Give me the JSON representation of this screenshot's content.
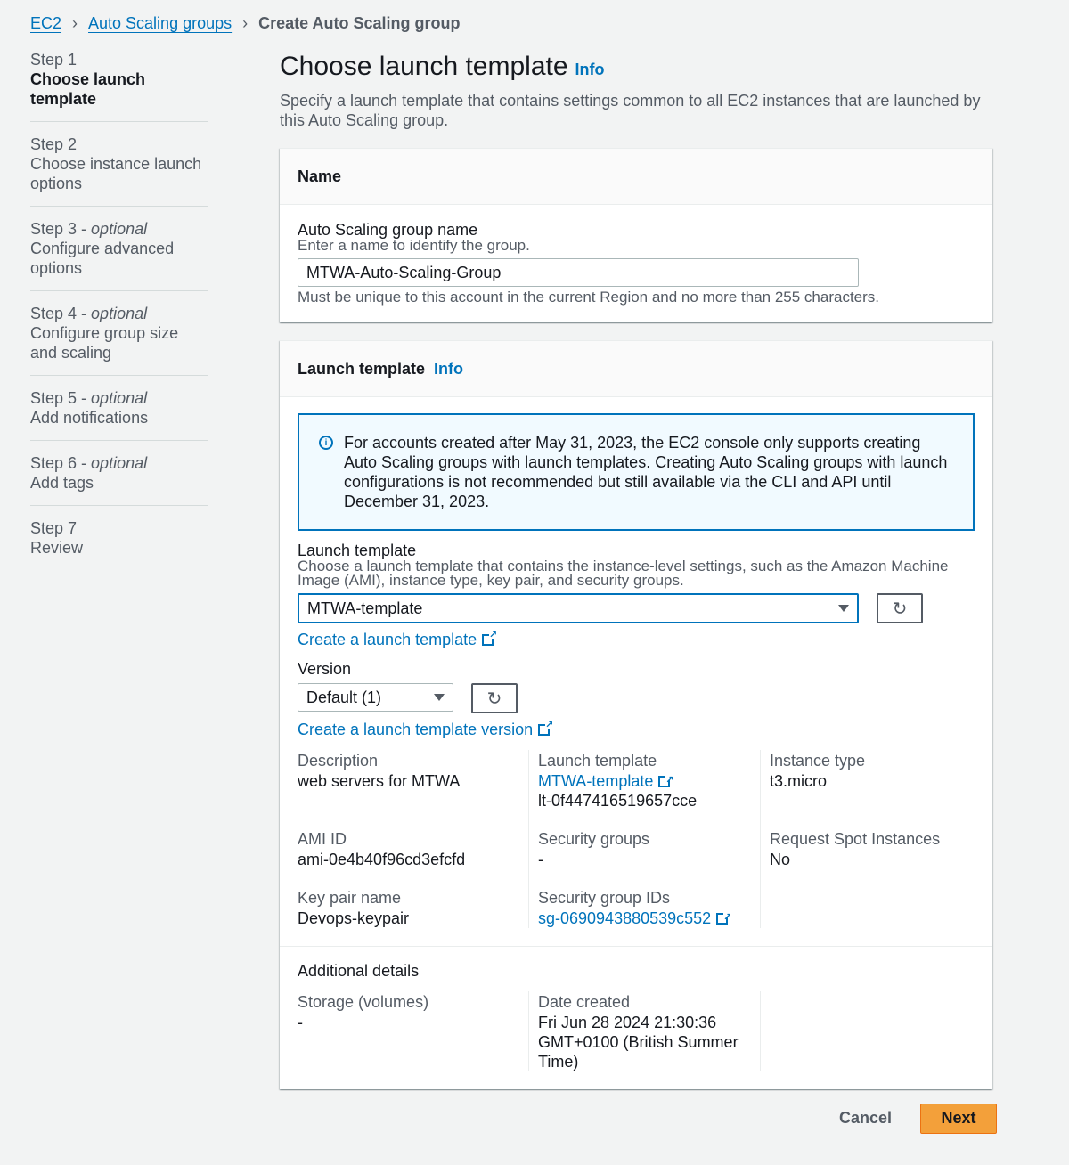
{
  "breadcrumb": {
    "items": [
      "EC2",
      "Auto Scaling groups"
    ],
    "current": "Create Auto Scaling group"
  },
  "steps": [
    {
      "num": "Step 1",
      "optional": "",
      "title": "Choose launch template"
    },
    {
      "num": "Step 2",
      "optional": "",
      "title": "Choose instance launch options"
    },
    {
      "num": "Step 3",
      "optional": "optional",
      "title": "Configure advanced options"
    },
    {
      "num": "Step 4",
      "optional": "optional",
      "title": "Configure group size and scaling"
    },
    {
      "num": "Step 5",
      "optional": "optional",
      "title": "Add notifications"
    },
    {
      "num": "Step 6",
      "optional": "optional",
      "title": "Add tags"
    },
    {
      "num": "Step 7",
      "optional": "",
      "title": "Review"
    }
  ],
  "page": {
    "title": "Choose launch template",
    "info": "Info",
    "description": "Specify a launch template that contains settings common to all EC2 instances that are launched by this Auto Scaling group."
  },
  "name_panel": {
    "header": "Name",
    "label": "Auto Scaling group name",
    "desc": "Enter a name to identify the group.",
    "value": "MTWA-Auto-Scaling-Group",
    "hint": "Must be unique to this account in the current Region and no more than 255 characters."
  },
  "launch_panel": {
    "header": "Launch template",
    "info": "Info",
    "alert": "For accounts created after May 31, 2023, the EC2 console only supports creating Auto Scaling groups with launch templates. Creating Auto Scaling groups with launch configurations is not recommended but still available via the CLI and API until December 31, 2023.",
    "lt_label": "Launch template",
    "lt_desc": "Choose a launch template that contains the instance-level settings, such as the Amazon Machine Image (AMI), instance type, key pair, and security groups.",
    "lt_value": "MTWA-template",
    "create_lt": "Create a launch template",
    "version_label": "Version",
    "version_value": "Default (1)",
    "create_version": "Create a launch template version",
    "details": {
      "description_key": "Description",
      "description_val": "web servers for MTWA",
      "lt_key": "Launch template",
      "lt_link": "MTWA-template",
      "lt_id": "lt-0f447416519657cce",
      "instance_type_key": "Instance type",
      "instance_type_val": "t3.micro",
      "ami_key": "AMI ID",
      "ami_val": "ami-0e4b40f96cd3efcfd",
      "sg_key": "Security groups",
      "sg_val": "-",
      "spot_key": "Request Spot Instances",
      "spot_val": "No",
      "keypair_key": "Key pair name",
      "keypair_val": "Devops-keypair",
      "sgid_key": "Security group IDs",
      "sgid_val": "sg-0690943880539c552"
    },
    "additional": {
      "title": "Additional details",
      "storage_key": "Storage (volumes)",
      "storage_val": "-",
      "date_key": "Date created",
      "date_val": "Fri Jun 28 2024 21:30:36 GMT+0100 (British Summer Time)"
    }
  },
  "footer": {
    "cancel": "Cancel",
    "next": "Next"
  }
}
